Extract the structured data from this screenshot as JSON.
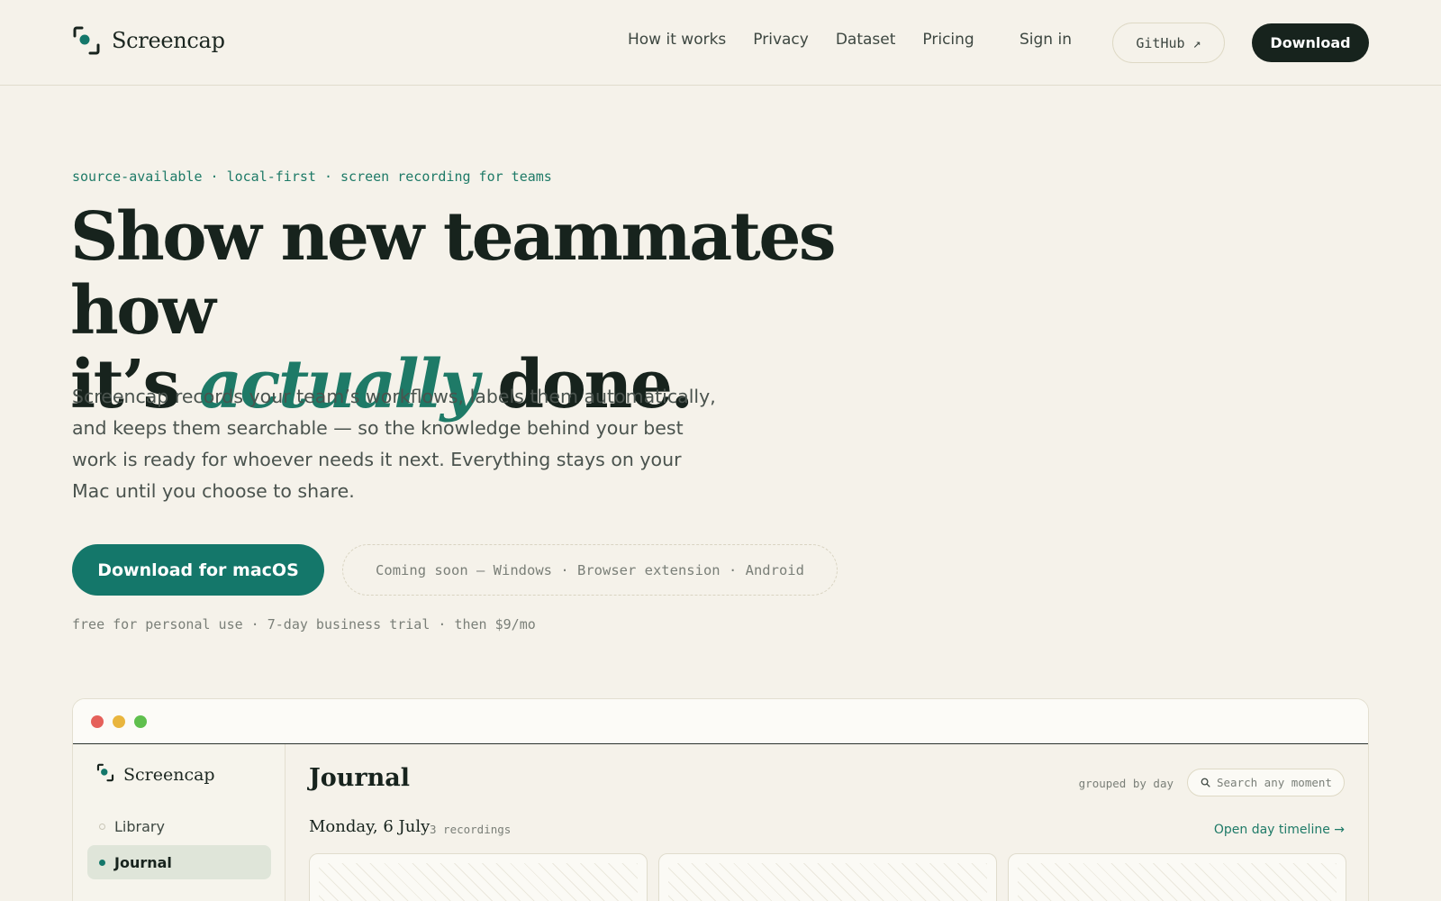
{
  "nav": {
    "brand": "Screencap",
    "links": [
      "How it works",
      "Privacy",
      "Dataset",
      "Pricing"
    ],
    "signin": "Sign in",
    "github": "GitHub ↗",
    "download": "Download"
  },
  "hero": {
    "eyebrow": "source-available · local-first · screen recording for teams",
    "headline_line1": "Show new teammates how",
    "headline_line2_pre": "it’s ",
    "headline_emphasis": "actually",
    "headline_line2_post": " done.",
    "lead": "Screencap records your team’s workflows, labels them automatically, and keeps them searchable — so the knowledge behind your best work is ready for whoever needs it next. Everything stays on your Mac until you choose to share.",
    "cta": "Download for macOS",
    "coming_soon": "Coming soon — Windows · Browser extension · Android",
    "pricing_note": "free for personal use · 7-day business trial · then $9/mo"
  },
  "app": {
    "window_controls": [
      "close",
      "minimize",
      "maximize"
    ],
    "sidebar": {
      "brand": "Screencap",
      "items": [
        {
          "label": "Library",
          "active": false
        },
        {
          "label": "Journal",
          "active": true
        }
      ]
    },
    "main": {
      "title": "Journal",
      "grouping": "grouped by day",
      "search_placeholder": "Search any moment",
      "day_label": "Monday, 6 July",
      "day_count": "3 recordings",
      "day_link": "Open day timeline →"
    }
  },
  "colors": {
    "background": "#f5f2ea",
    "accent": "#14776a",
    "ink": "#17231d",
    "close": "#e5605a",
    "minimize": "#e9b53d",
    "maximize": "#5fbf4d"
  },
  "icons": [
    "screencap-logo-icon",
    "external-link-icon",
    "search-icon",
    "bullet-dot-icon"
  ]
}
